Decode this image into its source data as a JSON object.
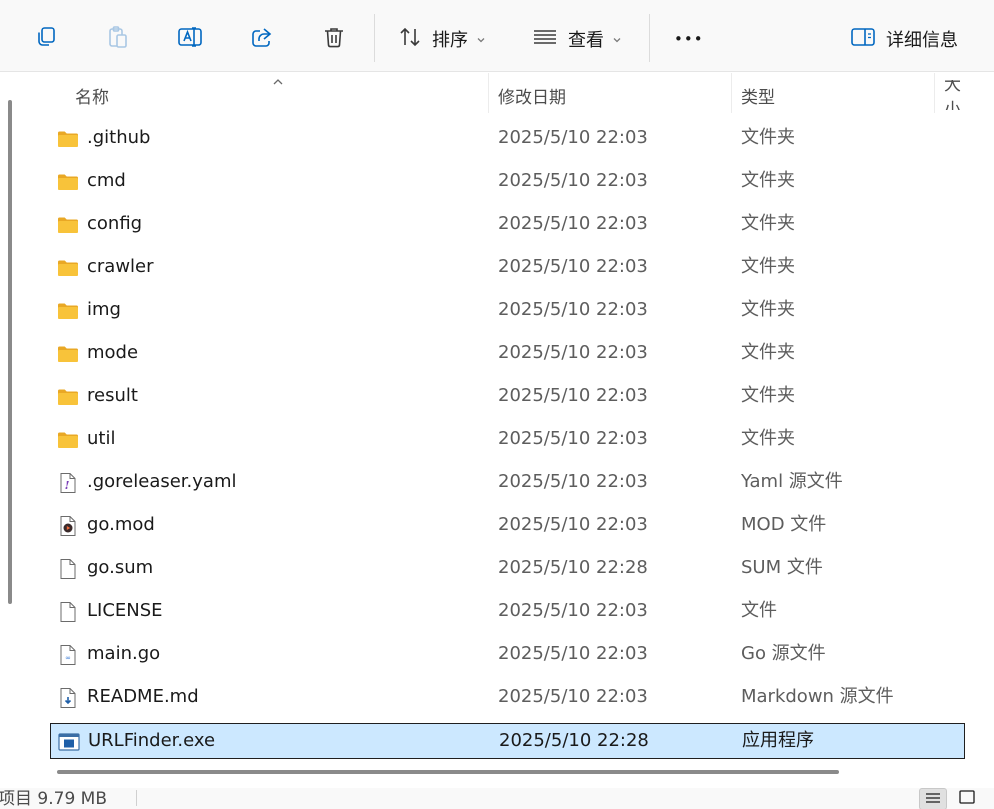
{
  "toolbar": {
    "sort_label": "排序",
    "view_label": "查看",
    "more_label": "•••",
    "details_label": "详细信息"
  },
  "columns": {
    "name": "名称",
    "date": "修改日期",
    "type": "类型",
    "size": "大小"
  },
  "files": [
    {
      "name": ".github",
      "date": "2025/5/10 22:03",
      "type": "文件夹",
      "icon": "folder-icon"
    },
    {
      "name": "cmd",
      "date": "2025/5/10 22:03",
      "type": "文件夹",
      "icon": "folder-icon"
    },
    {
      "name": "config",
      "date": "2025/5/10 22:03",
      "type": "文件夹",
      "icon": "folder-icon"
    },
    {
      "name": "crawler",
      "date": "2025/5/10 22:03",
      "type": "文件夹",
      "icon": "folder-icon"
    },
    {
      "name": "img",
      "date": "2025/5/10 22:03",
      "type": "文件夹",
      "icon": "folder-icon"
    },
    {
      "name": "mode",
      "date": "2025/5/10 22:03",
      "type": "文件夹",
      "icon": "folder-icon"
    },
    {
      "name": "result",
      "date": "2025/5/10 22:03",
      "type": "文件夹",
      "icon": "folder-icon"
    },
    {
      "name": "util",
      "date": "2025/5/10 22:03",
      "type": "文件夹",
      "icon": "folder-icon"
    },
    {
      "name": ".goreleaser.yaml",
      "date": "2025/5/10 22:03",
      "type": "Yaml 源文件",
      "icon": "yaml-file-icon"
    },
    {
      "name": "go.mod",
      "date": "2025/5/10 22:03",
      "type": "MOD 文件",
      "icon": "media-file-icon"
    },
    {
      "name": "go.sum",
      "date": "2025/5/10 22:28",
      "type": "SUM 文件",
      "icon": "blank-file-icon"
    },
    {
      "name": "LICENSE",
      "date": "2025/5/10 22:03",
      "type": "文件",
      "icon": "blank-file-icon"
    },
    {
      "name": "main.go",
      "date": "2025/5/10 22:03",
      "type": "Go 源文件",
      "icon": "go-file-icon"
    },
    {
      "name": "README.md",
      "date": "2025/5/10 22:03",
      "type": "Markdown 源文件",
      "icon": "markdown-file-icon"
    },
    {
      "name": "URLFinder.exe",
      "date": "2025/5/10 22:28",
      "type": "应用程序",
      "icon": "exe-file-icon",
      "selected": true
    }
  ],
  "status": {
    "selection_text": "项目  9.79 MB"
  },
  "colors": {
    "accent": "#0067c0",
    "selection_bg": "#cce8ff",
    "folder": "#f8c33a"
  }
}
